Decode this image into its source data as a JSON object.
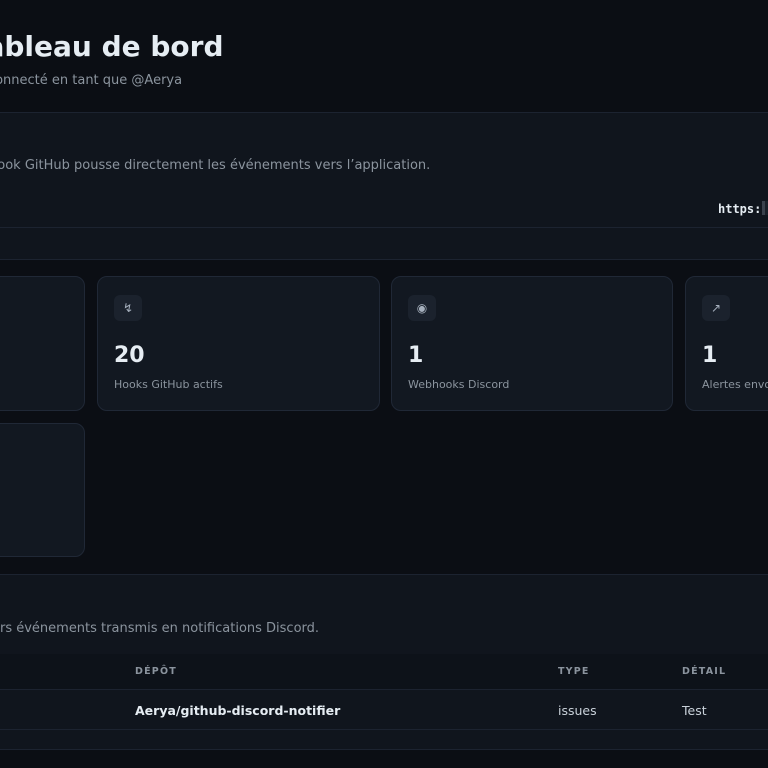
{
  "header": {
    "title": "Tableau de bord",
    "subtitle": "Connecté en tant que @Aerya"
  },
  "webhook": {
    "description": "Le webhook GitHub pousse directement les événements vers l’application.",
    "url_prefix": "https:"
  },
  "stats": [
    {
      "icon": "↯",
      "icon_name": "bolt-icon",
      "value": "20",
      "label": "Hooks GitHub actifs"
    },
    {
      "icon": "◉",
      "icon_name": "target-icon",
      "value": "1",
      "label": "Webhooks Discord"
    },
    {
      "icon": "↗",
      "icon_name": "trend-up-icon",
      "value": "1",
      "label": "Alertes envoyées"
    }
  ],
  "activity": {
    "description": "Derniers événements transmis en notifications Discord.",
    "columns": {
      "repo": "DÉPÔT",
      "type": "TYPE",
      "detail": "DÉTAIL"
    },
    "rows": [
      {
        "repo": "Aerya/github-discord-notifier",
        "type": "issues",
        "detail": "Test"
      }
    ]
  }
}
